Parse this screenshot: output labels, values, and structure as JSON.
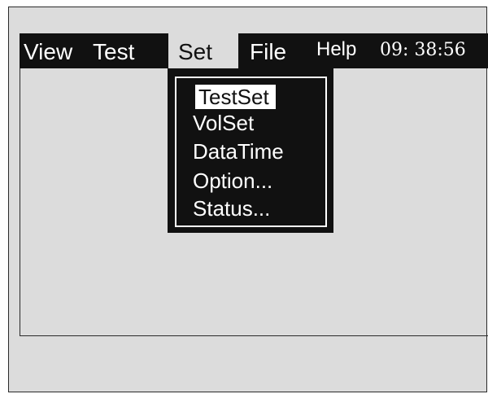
{
  "menubar": {
    "items": [
      {
        "label": "View"
      },
      {
        "label": "Test"
      },
      {
        "label": "Set"
      },
      {
        "label": "File"
      },
      {
        "label": "Help"
      }
    ],
    "clock": "09: 38:56"
  },
  "dropdown": {
    "parent": "Set",
    "selected": "TestSet",
    "items": [
      {
        "label": "TestSet"
      },
      {
        "label": "VolSet"
      },
      {
        "label": "DataTime"
      },
      {
        "label": "Option..."
      },
      {
        "label": "Status..."
      }
    ]
  },
  "colors": {
    "background": "#dcdcdc",
    "menubar": "#111111",
    "text_on_dark": "#ffffff"
  }
}
